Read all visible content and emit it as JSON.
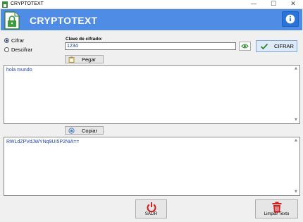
{
  "window": {
    "title": "CRYPTOTEXT",
    "controls": [
      "—",
      "☐",
      "✕"
    ]
  },
  "header": {
    "app_title": "CRYPTOTEXT",
    "info_icon": "info-icon",
    "bg_color": "#4f8ce6"
  },
  "mode": {
    "options": [
      {
        "label": "Cifrar",
        "selected": true
      },
      {
        "label": "Descifrar",
        "selected": false
      }
    ]
  },
  "key": {
    "label": "Clave de cifrado:",
    "value": "1234",
    "toggle_icon": "eye-icon"
  },
  "actions": {
    "cifrar_label": "CIFRAR",
    "cifrar_icon": "checkmark-icon",
    "paste_label": "Pegar",
    "paste_icon": "clipboard-icon",
    "copy_label": "Copiar",
    "copy_icon": "copy-icon"
  },
  "input_text": {
    "value": "hola mundo"
  },
  "output_text": {
    "value": "RWLdZPVdJWYNq9UI5P2NiA=="
  },
  "footer": {
    "exit_label": "SALIR",
    "exit_icon": "power-icon",
    "clear_label": "Limpiar Texto",
    "clear_icon": "trash-icon"
  }
}
